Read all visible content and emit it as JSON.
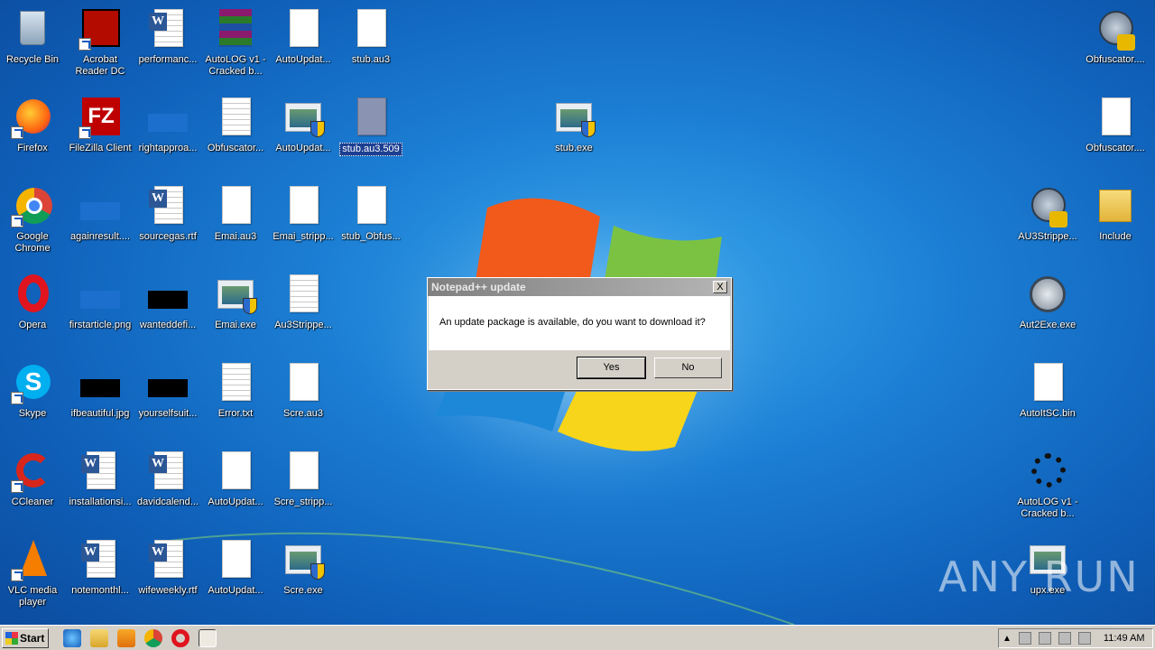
{
  "desktop": {
    "icons": [
      {
        "label": "Recycle Bin"
      },
      {
        "label": "Acrobat Reader DC"
      },
      {
        "label": "performanc..."
      },
      {
        "label": "AutoLOG v1 - Cracked b..."
      },
      {
        "label": "AutoUpdat..."
      },
      {
        "label": "stub.au3"
      },
      {
        "label": "Firefox"
      },
      {
        "label": "FileZilla Client"
      },
      {
        "label": "rightapproa..."
      },
      {
        "label": "Obfuscator..."
      },
      {
        "label": "AutoUpdat..."
      },
      {
        "label": "stub.au3.509"
      },
      {
        "label": "stub.exe"
      },
      {
        "label": "Google Chrome"
      },
      {
        "label": "againresult...."
      },
      {
        "label": "sourcegas.rtf"
      },
      {
        "label": "Emai.au3"
      },
      {
        "label": "Emai_stripp..."
      },
      {
        "label": "stub_Obfus..."
      },
      {
        "label": "Opera"
      },
      {
        "label": "firstarticle.png"
      },
      {
        "label": "wanteddefi..."
      },
      {
        "label": "Emai.exe"
      },
      {
        "label": "Au3Strippe..."
      },
      {
        "label": "Skype"
      },
      {
        "label": "ifbeautiful.jpg"
      },
      {
        "label": "yourselfsuit..."
      },
      {
        "label": "Error.txt"
      },
      {
        "label": "Scre.au3"
      },
      {
        "label": "CCleaner"
      },
      {
        "label": "installationsi..."
      },
      {
        "label": "davidcalend..."
      },
      {
        "label": "AutoUpdat..."
      },
      {
        "label": "Scre_stripp..."
      },
      {
        "label": "VLC media player"
      },
      {
        "label": "notemonthl..."
      },
      {
        "label": "wifeweekly.rtf"
      },
      {
        "label": "AutoUpdat..."
      },
      {
        "label": "Scre.exe"
      },
      {
        "label": "Obfuscator...."
      },
      {
        "label": "Obfuscator...."
      },
      {
        "label": "AU3Strippe..."
      },
      {
        "label": "Include"
      },
      {
        "label": "Aut2Exe.exe"
      },
      {
        "label": "AutoItSC.bin"
      },
      {
        "label": "AutoLOG v1 - Cracked b..."
      },
      {
        "label": "upx.exe"
      }
    ]
  },
  "dialog": {
    "title": "Notepad++ update",
    "message": "An update package is available, do you want to download it?",
    "yes_label": "Yes",
    "no_label": "No",
    "close_label": "X"
  },
  "taskbar": {
    "start_label": "Start",
    "clock": "11:49 AM"
  },
  "watermark": "ANY RUN"
}
